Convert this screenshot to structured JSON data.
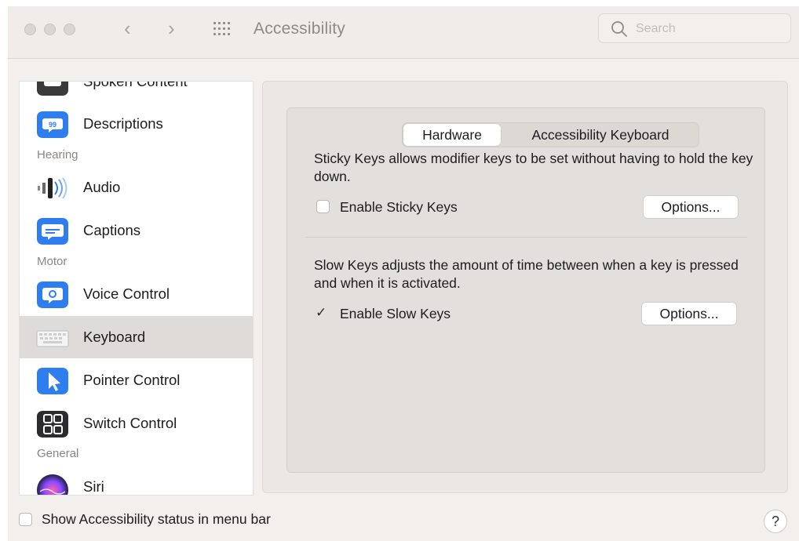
{
  "window": {
    "title": "Accessibility"
  },
  "search": {
    "placeholder": "Search"
  },
  "sidebar": {
    "partial_item": "Spoken Content",
    "items": [
      {
        "label": "Descriptions",
        "icon": "descriptions-icon"
      },
      {
        "label": "Audio",
        "icon": "audio-icon"
      },
      {
        "label": "Captions",
        "icon": "captions-icon"
      },
      {
        "label": "Voice Control",
        "icon": "voice-control-icon"
      },
      {
        "label": "Keyboard",
        "icon": "keyboard-icon",
        "selected": true
      },
      {
        "label": "Pointer Control",
        "icon": "pointer-icon"
      },
      {
        "label": "Switch Control",
        "icon": "switch-control-icon"
      },
      {
        "label": "Siri",
        "icon": "siri-icon"
      }
    ],
    "headers": {
      "hearing": "Hearing",
      "motor": "Motor",
      "general": "General"
    }
  },
  "tabs": {
    "hardware": "Hardware",
    "accessibility_keyboard": "Accessibility Keyboard",
    "active": "Hardware"
  },
  "sticky": {
    "description": "Sticky Keys allows modifier keys to be set without having to hold the key down.",
    "checkbox_label": "Enable Sticky Keys",
    "checked": false,
    "options_label": "Options..."
  },
  "slow": {
    "description": "Slow Keys adjusts the amount of time between when a key is pressed and when it is activated.",
    "checkbox_label": "Enable Slow Keys",
    "checked": true,
    "options_label": "Options..."
  },
  "footer": {
    "status_label": "Show Accessibility status in menu bar",
    "checked": false,
    "help_label": "?"
  },
  "colors": {
    "accent_blue": "#2f7ef0",
    "selected_row": "#dedbd8",
    "window_bg": "#f3efec"
  }
}
